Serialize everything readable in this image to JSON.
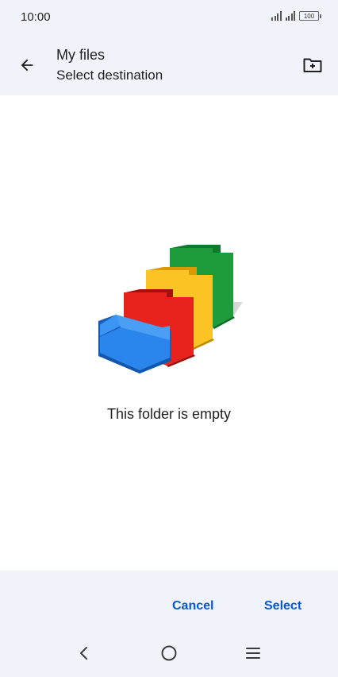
{
  "status_bar": {
    "time": "10:00",
    "battery": "100"
  },
  "app_bar": {
    "title": "My files",
    "subtitle": "Select destination",
    "back_icon": "arrow-back-icon",
    "new_folder_icon": "create-new-folder-icon"
  },
  "content": {
    "empty_message": "This folder is empty",
    "illustration": "empty-folders-illustration",
    "colors": {
      "green": "#1e9c3c",
      "yellow": "#fbc324",
      "red": "#e8221c",
      "blue": "#2a86ec"
    }
  },
  "actions": {
    "cancel_label": "Cancel",
    "select_label": "Select",
    "accent": "#0b57d0"
  },
  "nav_bar": {
    "back_icon": "nav-back-icon",
    "home_icon": "nav-home-icon",
    "menu_icon": "nav-menu-icon"
  }
}
